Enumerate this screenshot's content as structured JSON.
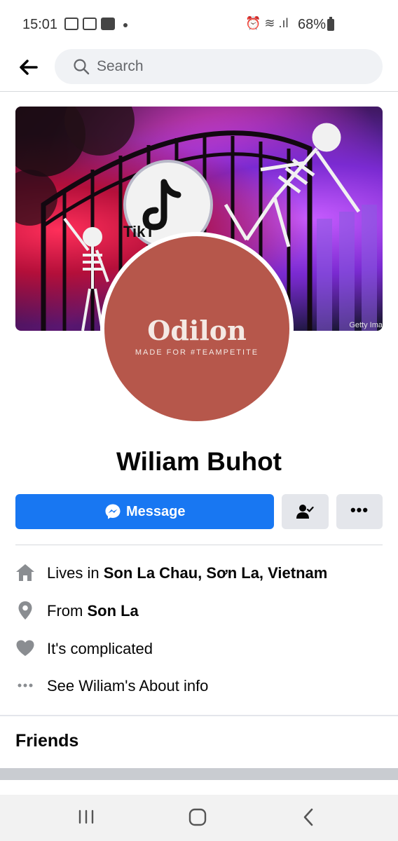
{
  "status_bar": {
    "time": "15:01",
    "battery": "68%",
    "signal_glyphs": "⏰ ≋ .ıl"
  },
  "search": {
    "placeholder": "Search"
  },
  "cover": {
    "credit": "Getty Ima"
  },
  "avatar": {
    "brand": "Odilon",
    "tagline": "MADE FOR #TEAMPETITE"
  },
  "profile": {
    "name": "Wiliam Buhot"
  },
  "actions": {
    "message_label": "Message",
    "more_glyph": "•••"
  },
  "details": {
    "lives_prefix": "Lives in ",
    "lives_value": "Son La Chau, Sơn La, Vietnam",
    "from_prefix": "From ",
    "from_value": "Son La",
    "relationship": "It's complicated",
    "about_link": "See Wiliam's About info"
  },
  "friends": {
    "title": "Friends"
  },
  "colors": {
    "accent": "#1877f2",
    "avatar_bg": "#b6574b",
    "icon_gray": "#8a8d91"
  }
}
